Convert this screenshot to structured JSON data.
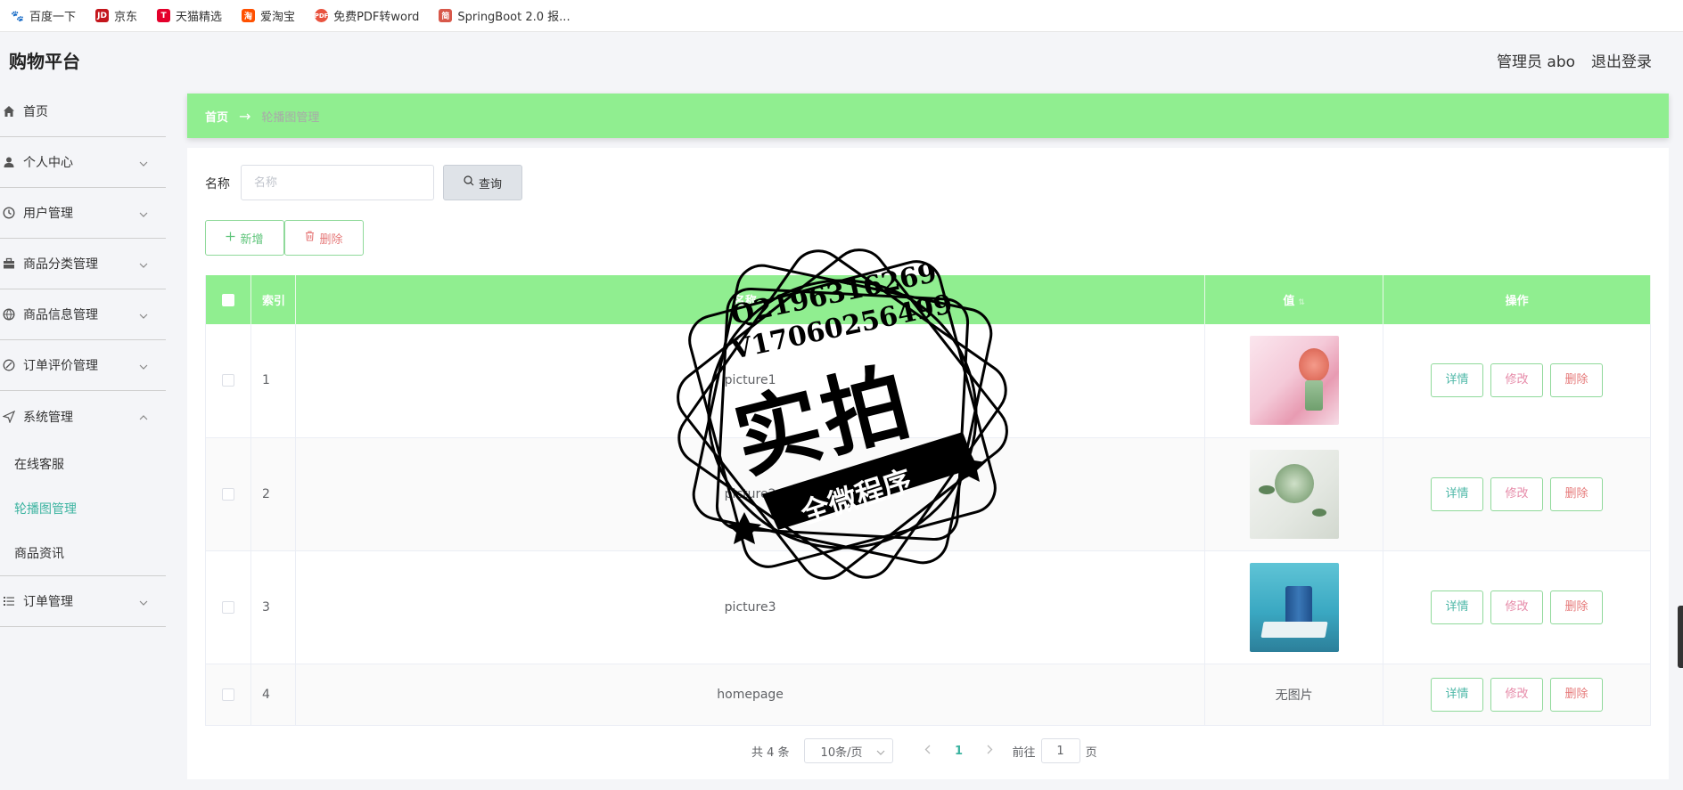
{
  "bookmarks": [
    {
      "label": "百度一下",
      "icon": "baidu-paw-icon",
      "color": "#2932e1"
    },
    {
      "label": "京东",
      "icon": "jd-icon",
      "color": "#c4161c"
    },
    {
      "label": "天猫精选",
      "icon": "tmall-icon",
      "color": "#e4002b"
    },
    {
      "label": "爱淘宝",
      "icon": "taobao-icon",
      "color": "#ff5000"
    },
    {
      "label": "免费PDF转word",
      "icon": "pdf-icon",
      "color": "#e9533f"
    },
    {
      "label": "SpringBoot 2.0 报...",
      "icon": "jian-icon",
      "color": "#d8584a"
    }
  ],
  "header": {
    "brand": "购物平台",
    "admin": "管理员 abo",
    "logout": "退出登录"
  },
  "sidebar": {
    "items": [
      {
        "label": "首页",
        "icon": "home-icon"
      },
      {
        "label": "个人中心",
        "icon": "user-icon"
      },
      {
        "label": "用户管理",
        "icon": "clock-icon"
      },
      {
        "label": "商品分类管理",
        "icon": "briefcase-icon"
      },
      {
        "label": "商品信息管理",
        "icon": "globe-icon"
      },
      {
        "label": "订单评价管理",
        "icon": "comment-icon"
      },
      {
        "label": "系统管理",
        "icon": "send-icon"
      },
      {
        "label": "订单管理",
        "icon": "list-icon"
      }
    ],
    "sub_items": [
      "在线客服",
      "轮播图管理",
      "商品资讯"
    ],
    "active_sub": "轮播图管理"
  },
  "breadcrumb": {
    "home": "首页",
    "arrow": "→",
    "current": "轮播图管理"
  },
  "search": {
    "label": "名称",
    "placeholder": "名称",
    "button": "查询"
  },
  "actions": {
    "add": "新增",
    "delete": "删除"
  },
  "table": {
    "headers": {
      "index": "索引",
      "name": "名称",
      "value": "值",
      "ops": "操作"
    },
    "sort_indicator": "⇅",
    "ops": {
      "detail": "详情",
      "edit": "修改",
      "delete": "删除"
    },
    "rows": [
      {
        "index": "1",
        "name": "picture1",
        "image": "pink-flower-banner",
        "colors": [
          "#f7d8e4",
          "#e8a4b8"
        ]
      },
      {
        "index": "2",
        "name": "picture2",
        "image": "green-bouquet",
        "colors": [
          "#eef0ee",
          "#9fb89c"
        ]
      },
      {
        "index": "3",
        "name": "picture3",
        "image": "blue-cosmetics-book",
        "colors": [
          "#3fb0c8",
          "#2a6e8e"
        ]
      },
      {
        "index": "4",
        "name": "homepage",
        "value_text": "无图片"
      }
    ]
  },
  "pagination": {
    "total": "共 4 条",
    "page_size": "10条/页",
    "current_page": "1",
    "goto_label": "前往",
    "goto_value": "1",
    "page_suffix": "页"
  },
  "watermark": {
    "line1": "Q2196316269",
    "line2": "V17060256499",
    "main": "实拍",
    "ribbon": "全微程序"
  },
  "colors": {
    "accent_green": "#90ee90",
    "active_teal": "#3bb3a0"
  }
}
